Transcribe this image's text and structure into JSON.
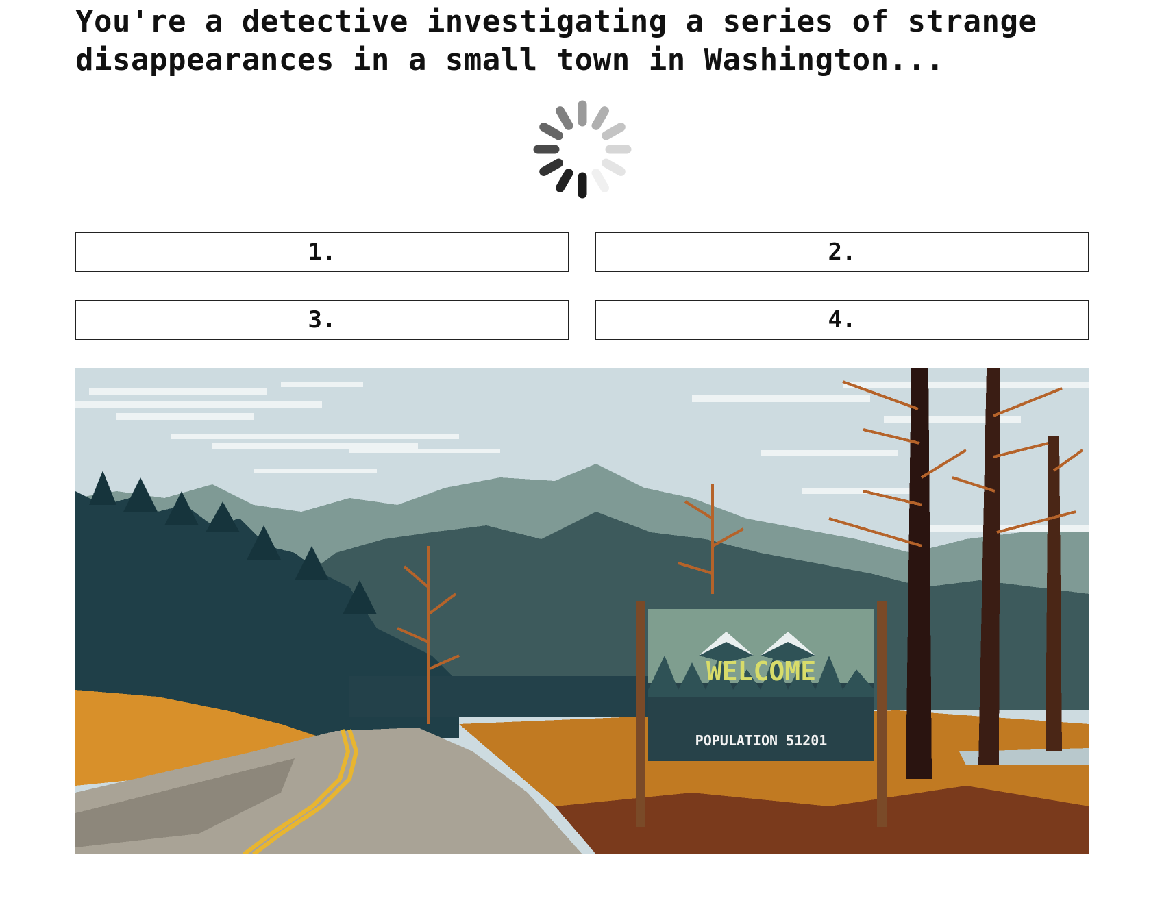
{
  "story": {
    "prompt": "You're a detective investigating a series of strange disappearances in a small town in Washington..."
  },
  "loading": {
    "icon": "loading-spinner-icon"
  },
  "choices": [
    {
      "label": "1."
    },
    {
      "label": "2."
    },
    {
      "label": "3."
    },
    {
      "label": "4."
    }
  ],
  "scene": {
    "sign_title": "WELCOME",
    "sign_subtitle": "POPULATION 51201",
    "colors": {
      "sky": "#cddbe0",
      "mountain_far": "#7f9a95",
      "mountain_near": "#3d5a5c",
      "forest": "#1f3f48",
      "road": "#a9a396",
      "road_line": "#e8b530",
      "autumn": "#d8902a",
      "sign_panel": "#7f9e8f",
      "sign_text": "#d8dc6a",
      "sign_post": "#7a4a28"
    }
  }
}
